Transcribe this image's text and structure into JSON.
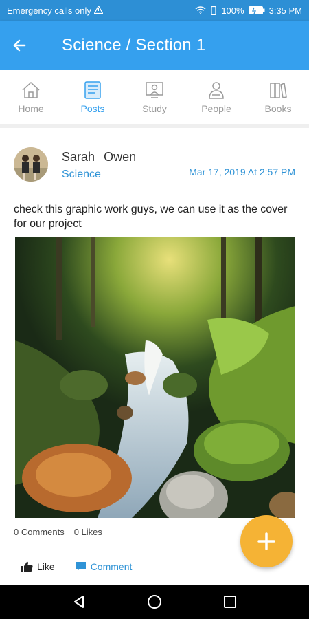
{
  "status_bar": {
    "left_text": "Emergency calls only",
    "battery": "100%",
    "time": "3:35 PM"
  },
  "app_bar": {
    "title": "Science / Section 1"
  },
  "tabs": [
    {
      "label": "Home",
      "icon": "home-icon",
      "active": false
    },
    {
      "label": "Posts",
      "icon": "posts-icon",
      "active": true
    },
    {
      "label": "Study",
      "icon": "study-icon",
      "active": false
    },
    {
      "label": "People",
      "icon": "people-icon",
      "active": false
    },
    {
      "label": "Books",
      "icon": "books-icon",
      "active": false
    }
  ],
  "post": {
    "author_first": "Sarah",
    "author_last": "Owen",
    "subject": "Science",
    "date": "Mar 17, 2019 At 2:57 PM",
    "text": "check this graphic work guys, we can use it as the cover for our project",
    "comments": "0 Comments",
    "likes": "0 Likes",
    "like_label": "Like",
    "comment_label": "Comment"
  },
  "colors": {
    "primary": "#35a0ee",
    "status_bar": "#2d8fd5",
    "fab": "#f5b335",
    "link": "#2f93d6"
  }
}
